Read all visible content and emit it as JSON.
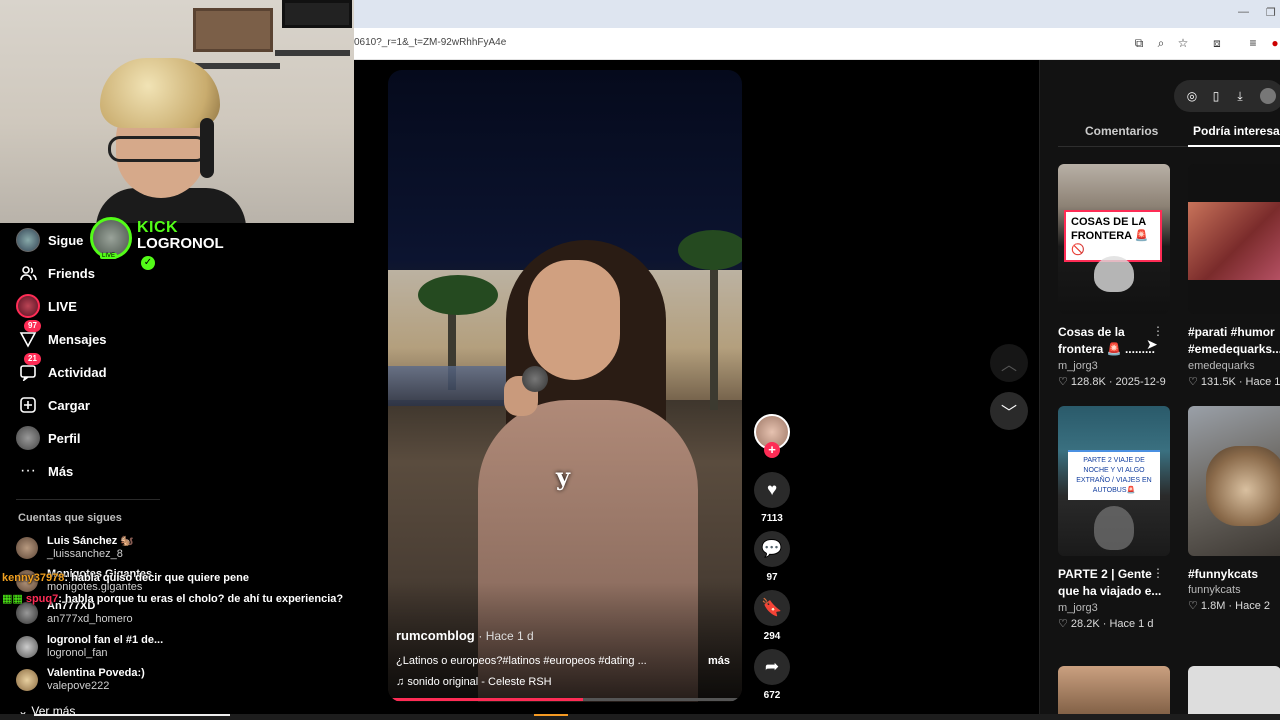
{
  "browser": {
    "url": "0610?_r=1&_t=ZM-92wRhhFyA4e"
  },
  "streamer_overlay": {
    "kick_logo": "KICK",
    "kick_name": "LOGRONOL",
    "live_label": "LIVE",
    "brand_color": "#53fc18"
  },
  "nav": {
    "items": [
      {
        "label": "Sigue",
        "icon": "avatar-icon"
      },
      {
        "label": "Friends",
        "icon": "friends-icon"
      },
      {
        "label": "LIVE",
        "icon": "live-icon"
      },
      {
        "label": "Mensajes",
        "icon": "messages-icon",
        "badge": "97"
      },
      {
        "label": "Actividad",
        "icon": "activity-icon",
        "badge": "21"
      },
      {
        "label": "Cargar",
        "icon": "upload-icon"
      },
      {
        "label": "Perfil",
        "icon": "profile-icon"
      },
      {
        "label": "Más",
        "icon": "more-icon"
      }
    ],
    "following_title": "Cuentas que sigues",
    "following": [
      {
        "name": "Luis Sánchez 🐿️",
        "handle": "_luissanchez_8"
      },
      {
        "name": "Monigotes Gigantes",
        "handle": "monigotes.gigantes"
      },
      {
        "name": "An777XD",
        "handle": "an777xd_homero"
      },
      {
        "name": "logronol fan el #1 de...",
        "handle": "logronol_fan"
      },
      {
        "name": "Valentina Poveda:)",
        "handle": "valepove222"
      }
    ],
    "see_more": "Ver más"
  },
  "chat": [
    {
      "user": "kenny37978",
      "text": ": habla quiso decir que quiere pene"
    },
    {
      "user": "spuq7",
      "text": ": habla porque tu eras el cholo? de ahí tu experiencia?"
    }
  ],
  "video": {
    "caption": "y",
    "author": "rumcomblog",
    "time": "· Hace 1 d",
    "description": "¿Latinos o europeos?#latinos #europeos #dating ...",
    "more": "más",
    "sound": "sonido original - Celeste RSH",
    "progress": 0.55,
    "likes": "7113",
    "comments": "97",
    "saves": "294",
    "shares": "672",
    "accent": "#fe2c55"
  },
  "panel": {
    "tabs": [
      "Comentarios",
      "Podría interesarte"
    ],
    "active_tab": 1,
    "cards": [
      {
        "title": "Cosas de la frontera 🚨 .........",
        "thumb_text": "COSAS DE LA FRONTERA 🚨🚫",
        "user": "m_jorg3",
        "meta": "♡ 128.8K · 2025-12-9"
      },
      {
        "title": "#parati #humor #emedequarks...",
        "thumb_text": "",
        "user": "emedequarks",
        "meta": "♡ 131.5K · Hace 1"
      },
      {
        "title": "PARTE 2 | Gente que ha viajado e...",
        "thumb_text": "PARTE 2 VIAJE DE NOCHE Y VI ALGO EXTRAÑO / VIAJES EN AUTOBUS🚨",
        "user": "m_jorg3",
        "meta": "♡ 28.2K · Hace 1 d"
      },
      {
        "title": "#funnykcats",
        "thumb_text": "",
        "user": "funnykcats",
        "meta": "♡ 1.8M · Hace 2"
      }
    ]
  }
}
